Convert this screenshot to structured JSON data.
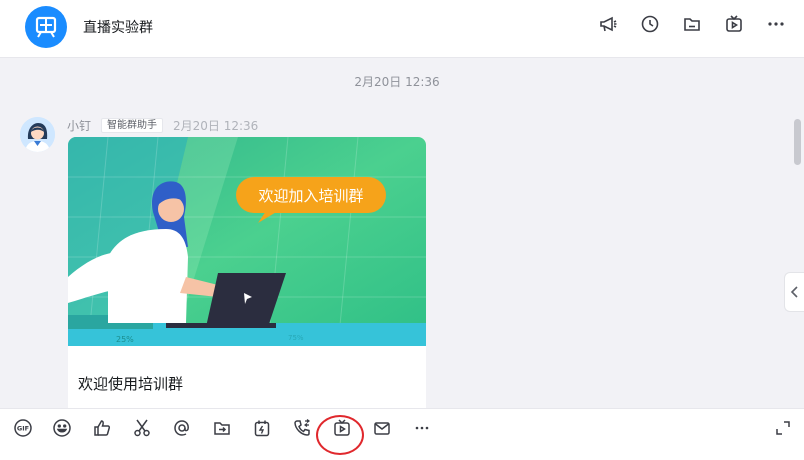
{
  "header": {
    "group_name": "直播实验群",
    "icons": [
      "announcement-icon",
      "history-clock-icon",
      "folder-icon",
      "live-tv-icon",
      "more-icon"
    ]
  },
  "chat": {
    "timestamp": "2月20日 12:36",
    "message": {
      "sender": "小钉",
      "badge": "智能群助手",
      "time": "2月20日 12:36",
      "card_image_text": "欢迎加入培训群",
      "card_caption": "欢迎使用培训群",
      "chart_labels": [
        "25%",
        "75%"
      ]
    }
  },
  "toolbar": {
    "gif_label": "GIF",
    "icons": [
      "gif-icon",
      "emoji-icon",
      "thumbs-up-icon",
      "scissors-icon",
      "mention-icon",
      "file-transfer-icon",
      "todo-icon",
      "call-icon",
      "live-tv-icon",
      "mail-icon",
      "more-icon",
      "expand-icon"
    ]
  },
  "colors": {
    "accent_blue": "#1a8cff",
    "highlight_red": "#e0282d",
    "card_green": "#3cc28a",
    "bubble_orange": "#f6a31a"
  }
}
